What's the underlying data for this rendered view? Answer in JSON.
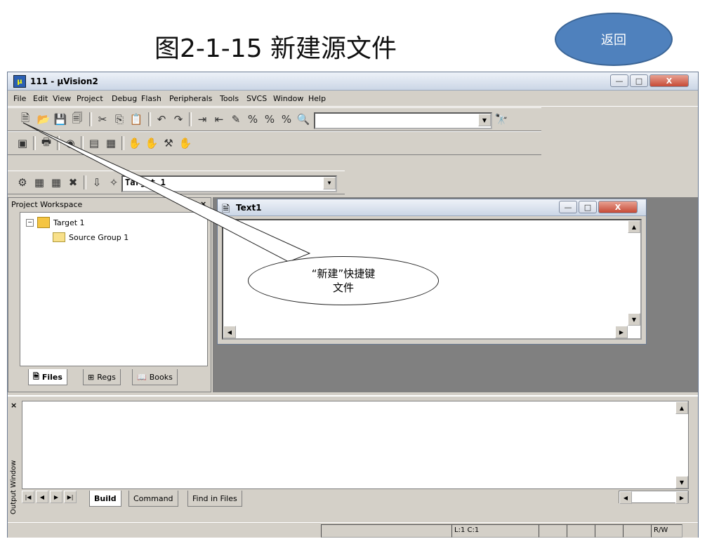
{
  "slide": {
    "title": "图2-1-15  新建源文件",
    "back_label": "返回"
  },
  "window": {
    "title": "111 - µVision2",
    "icon": "uvision-icon",
    "minimize": "—",
    "maximize": "□",
    "close": "X"
  },
  "menu": [
    "File",
    "Edit",
    "View",
    "Project",
    "Debug",
    "Flash",
    "Peripherals",
    "Tools",
    "SVCS",
    "Window",
    "Help"
  ],
  "toolbar": {
    "find_value": ""
  },
  "build_toolbar": {
    "target_value": "Target 1"
  },
  "workspace": {
    "title": "Project Workspace",
    "close": "×",
    "tree": [
      {
        "label": "Target 1",
        "icon": "target-folder-icon"
      },
      {
        "label": "Source Group 1",
        "icon": "folder-icon"
      }
    ],
    "tabs": [
      {
        "label": "Files",
        "icon": "file-icon"
      },
      {
        "label": "Regs",
        "icon": "registers-icon"
      },
      {
        "label": "Books",
        "icon": "book-icon"
      }
    ]
  },
  "editor": {
    "title": "Text1",
    "icon": "document-icon"
  },
  "callout": {
    "line1": "“新建”快捷键",
    "line2": "文件"
  },
  "output": {
    "side_label": "Output Window",
    "close": "×",
    "tabs": [
      "Build",
      "Command",
      "Find in Files"
    ]
  },
  "status": {
    "position": "L:1 C:1",
    "mode": "R/W"
  }
}
